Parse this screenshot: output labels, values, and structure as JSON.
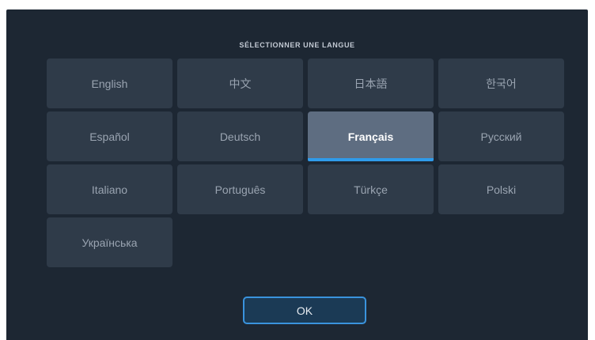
{
  "dialog": {
    "title": "SÉLECTIONNER UNE LANGUE",
    "selected_language": "Français",
    "languages": [
      "English",
      "中文",
      "日本語",
      "한국어",
      "Español",
      "Deutsch",
      "Français",
      "Русский",
      "Italiano",
      "Português",
      "Türkçe",
      "Polski",
      "Українська"
    ],
    "ok_label": "OK"
  },
  "colors": {
    "background": "#1d2733",
    "button": "#2f3b49",
    "selected_button": "#5e6d81",
    "accent": "#2f9bea",
    "text": "#9aa4b1",
    "selected_text": "#ffffff"
  }
}
